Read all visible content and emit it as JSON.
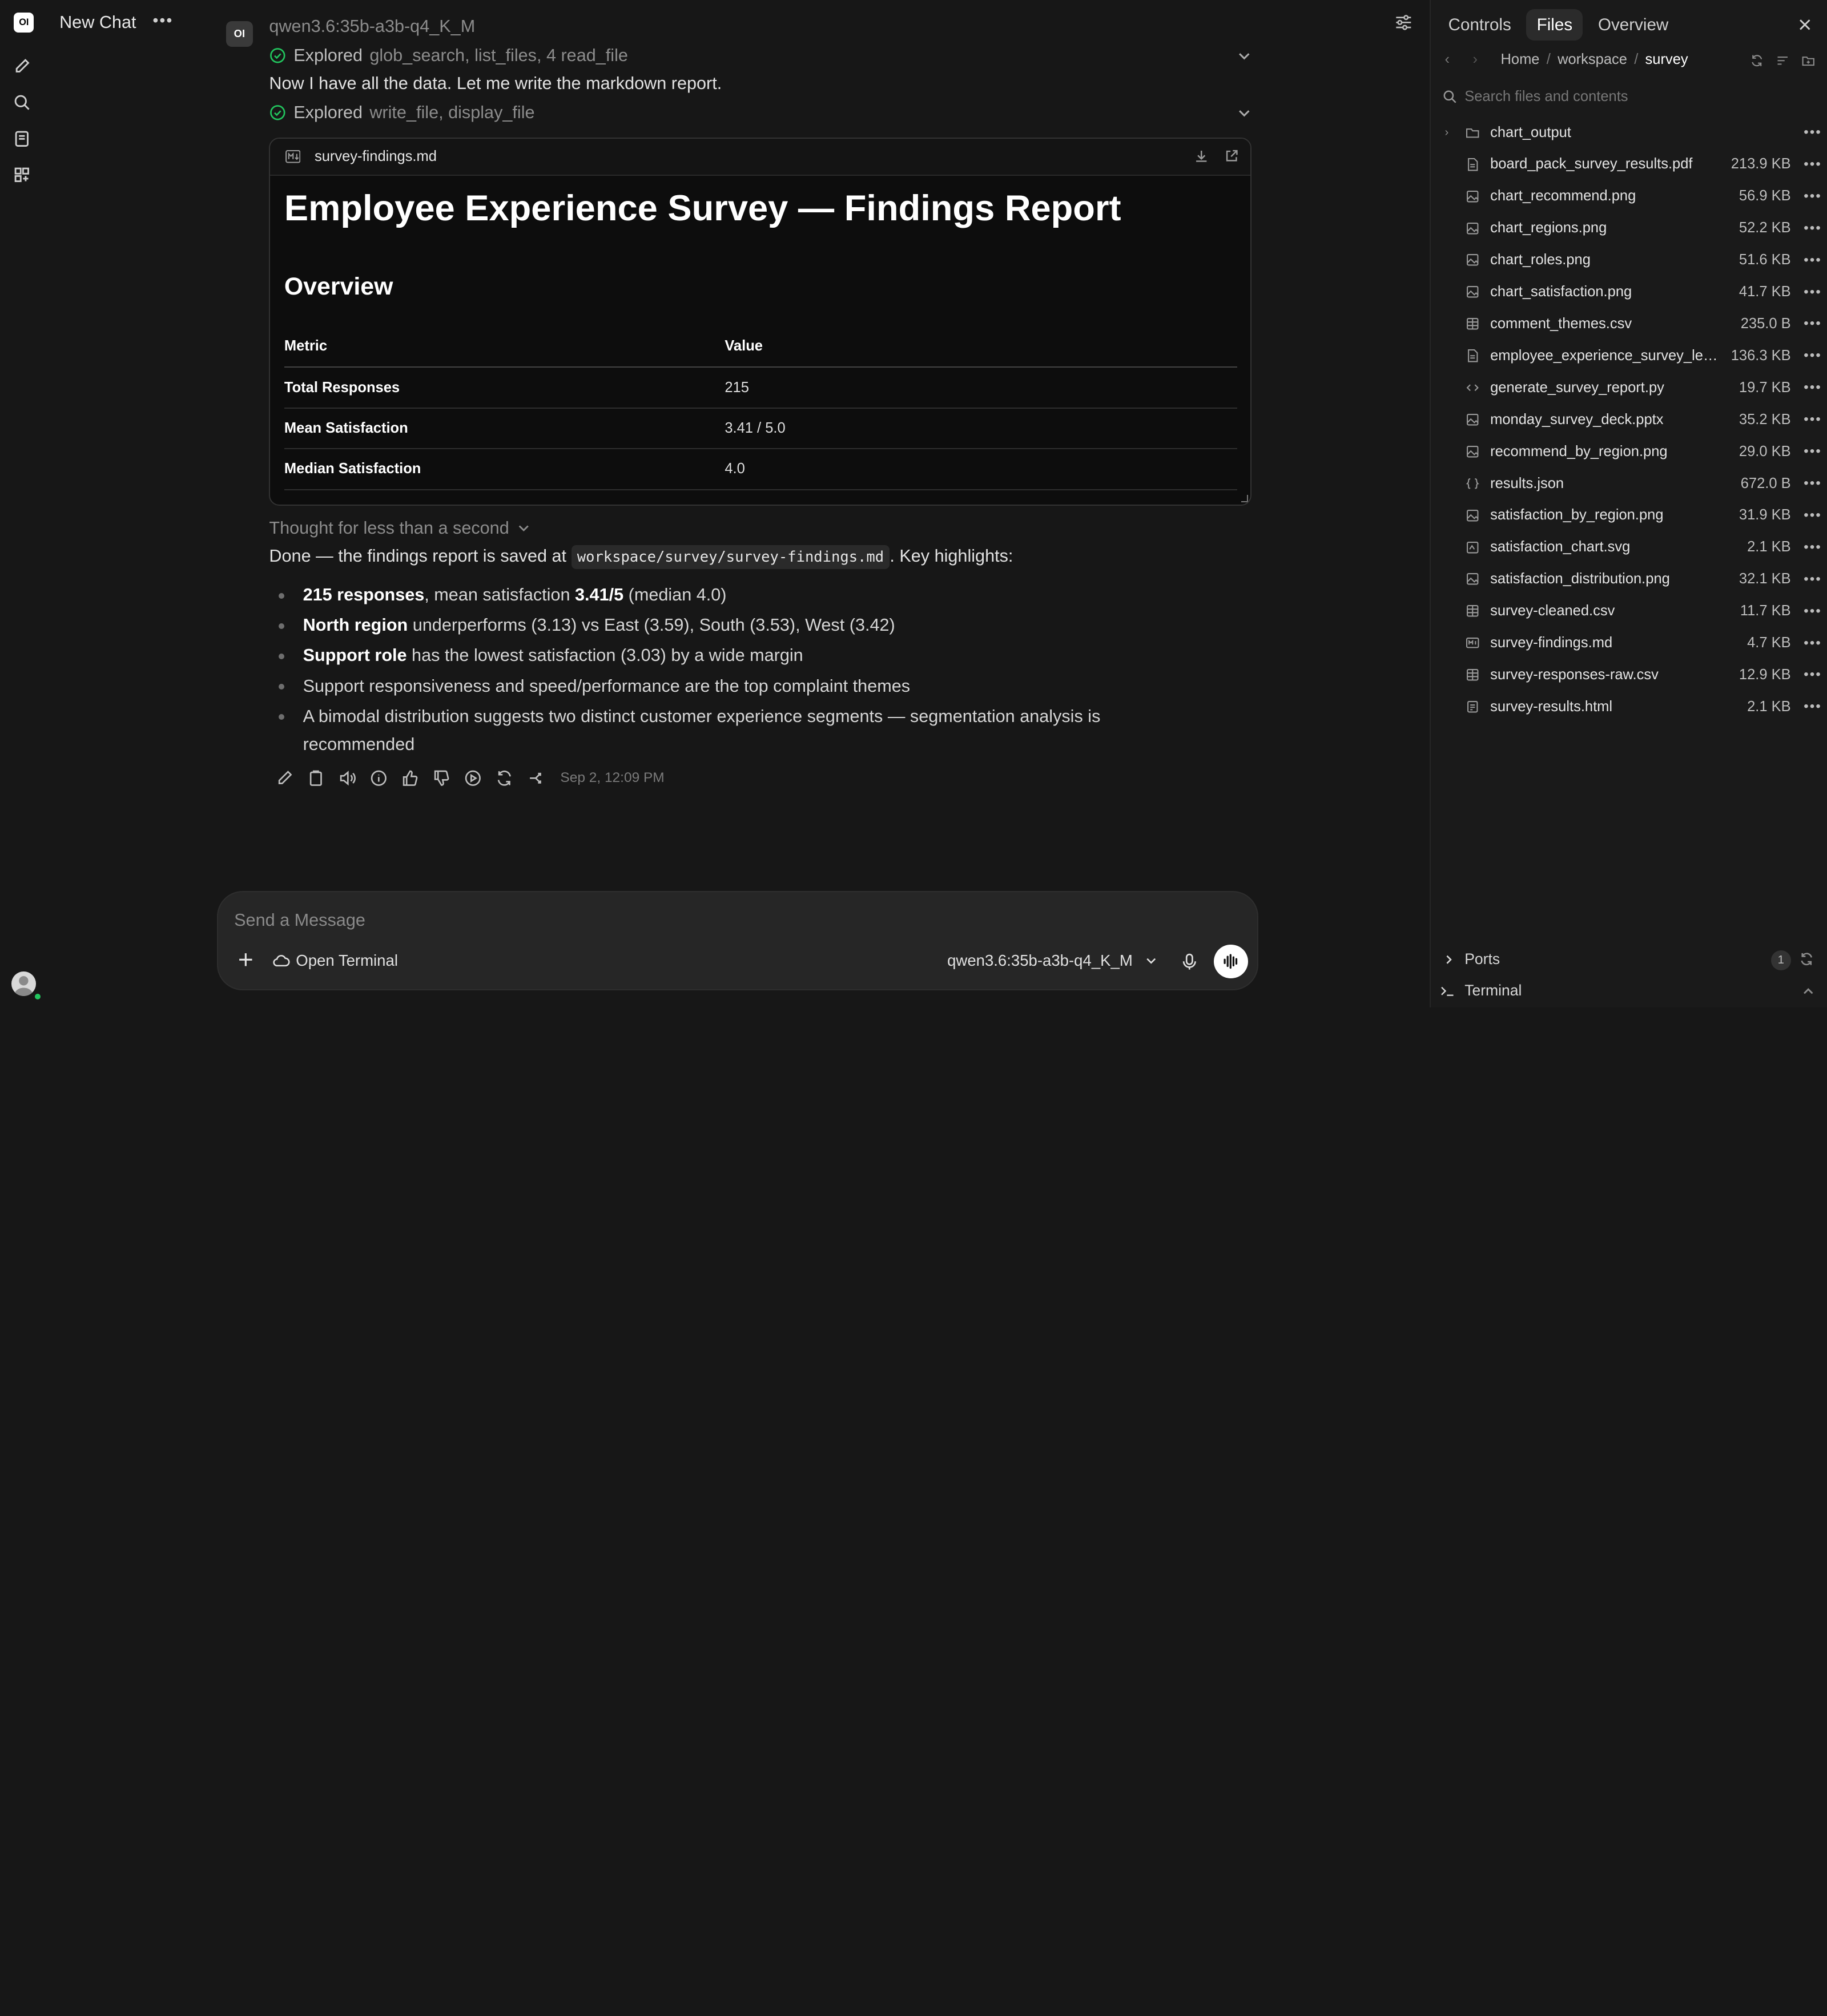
{
  "app": {
    "logo_text": "OI"
  },
  "header": {
    "chat_title": "New Chat"
  },
  "message": {
    "model_badge": "OI",
    "model_name": "qwen3.6:35b-a3b-q4_K_M",
    "explored_1": {
      "label": "Explored",
      "tools": "glob_search, list_files, 4 read_file"
    },
    "line_1": "Now I have all the data. Let me write the markdown report.",
    "explored_2": {
      "label": "Explored",
      "tools": "write_file, display_file"
    },
    "thought": "Thought for less than a second",
    "done_prefix": "Done — the findings report is saved at ",
    "done_path": "workspace/survey/survey-findings.md",
    "done_suffix": ". Key highlights:",
    "bullets": [
      {
        "bold": "215 responses",
        "text": ", mean satisfaction ",
        "bold2": "3.41/5",
        "text2": " (median 4.0)"
      },
      {
        "bold": "North region",
        "text": " underperforms (3.13) vs East (3.59), South (3.53), West (3.42)"
      },
      {
        "bold": "Support role",
        "text": " has the lowest satisfaction (3.03) by a wide margin"
      },
      {
        "text": "Support responsiveness and speed/performance are the top complaint themes"
      },
      {
        "text": "A bimodal distribution suggests two distinct customer experience segments — segmentation analysis is recommended"
      }
    ],
    "timestamp": "Sep 2, 12:09 PM"
  },
  "document": {
    "filename": "survey-findings.md",
    "h1": "Employee Experience Survey — Findings Report",
    "h2": "Overview",
    "table": {
      "headers": [
        "Metric",
        "Value"
      ],
      "rows": [
        [
          "Total Responses",
          "215"
        ],
        [
          "Mean Satisfaction",
          "3.41 / 5.0"
        ],
        [
          "Median Satisfaction",
          "4.0"
        ]
      ]
    }
  },
  "composer": {
    "placeholder": "Send a Message",
    "terminal_label": "Open Terminal",
    "model": "qwen3.6:35b-a3b-q4_K_M"
  },
  "panel": {
    "tabs": [
      "Controls",
      "Files",
      "Overview"
    ],
    "active_tab": "Files",
    "breadcrumb": [
      "Home",
      "workspace",
      "survey"
    ],
    "search_placeholder": "Search files and contents",
    "files": [
      {
        "name": "chart_output",
        "size": "",
        "type": "folder"
      },
      {
        "name": "board_pack_survey_results.pdf",
        "size": "213.9 KB",
        "type": "doc"
      },
      {
        "name": "chart_recommend.png",
        "size": "56.9 KB",
        "type": "image"
      },
      {
        "name": "chart_regions.png",
        "size": "52.2 KB",
        "type": "image"
      },
      {
        "name": "chart_roles.png",
        "size": "51.6 KB",
        "type": "image"
      },
      {
        "name": "chart_satisfaction.png",
        "size": "41.7 KB",
        "type": "image"
      },
      {
        "name": "comment_themes.csv",
        "size": "235.0 B",
        "type": "table"
      },
      {
        "name": "employee_experience_survey_lead...",
        "size": "136.3 KB",
        "type": "doc"
      },
      {
        "name": "generate_survey_report.py",
        "size": "19.7 KB",
        "type": "code"
      },
      {
        "name": "monday_survey_deck.pptx",
        "size": "35.2 KB",
        "type": "image"
      },
      {
        "name": "recommend_by_region.png",
        "size": "29.0 KB",
        "type": "image"
      },
      {
        "name": "results.json",
        "size": "672.0 B",
        "type": "json"
      },
      {
        "name": "satisfaction_by_region.png",
        "size": "31.9 KB",
        "type": "image"
      },
      {
        "name": "satisfaction_chart.svg",
        "size": "2.1 KB",
        "type": "svg"
      },
      {
        "name": "satisfaction_distribution.png",
        "size": "32.1 KB",
        "type": "image"
      },
      {
        "name": "survey-cleaned.csv",
        "size": "11.7 KB",
        "type": "table"
      },
      {
        "name": "survey-findings.md",
        "size": "4.7 KB",
        "type": "md"
      },
      {
        "name": "survey-responses-raw.csv",
        "size": "12.9 KB",
        "type": "table"
      },
      {
        "name": "survey-results.html",
        "size": "2.1 KB",
        "type": "html"
      }
    ],
    "ports_label": "Ports",
    "ports_count": "1",
    "terminal_label": "Terminal"
  },
  "colors": {
    "background": "#171717",
    "panel": "#1a1a1a",
    "accent_green": "#22c55e"
  }
}
